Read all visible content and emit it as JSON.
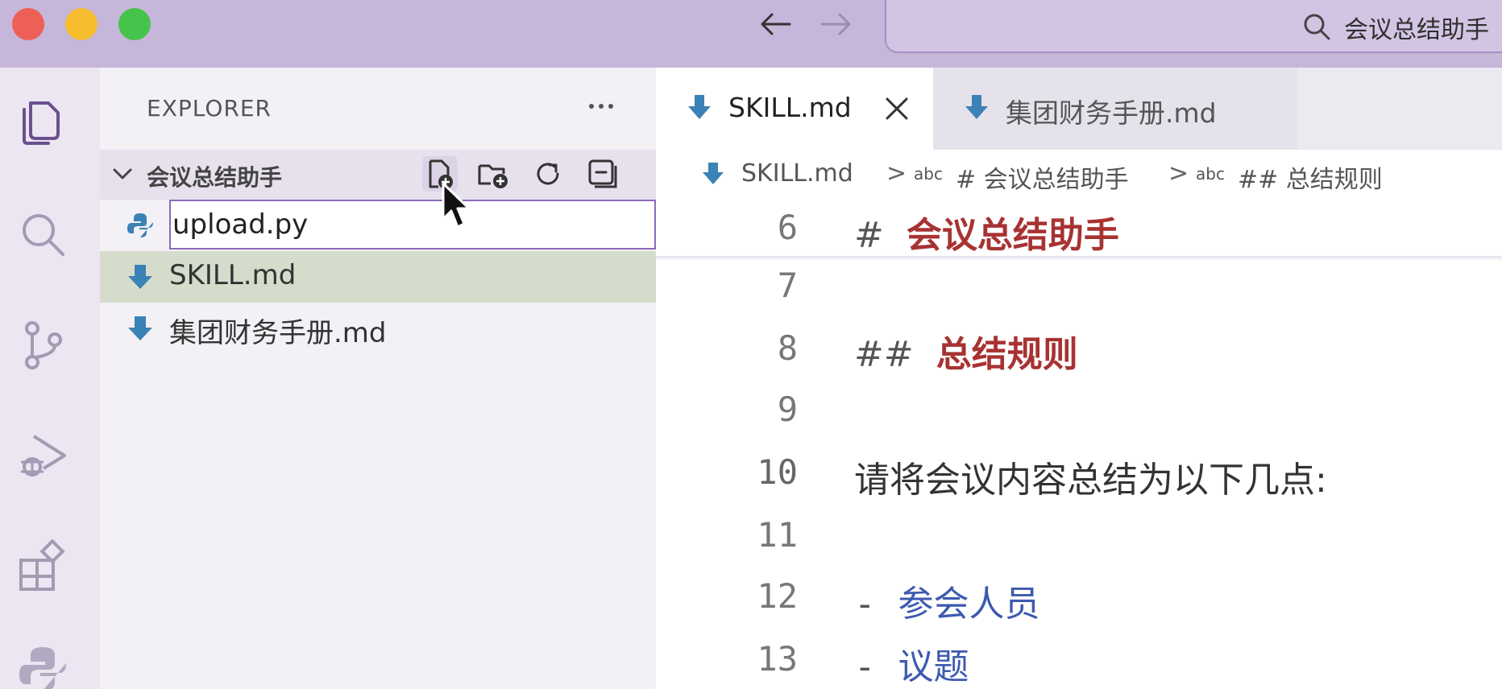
{
  "window": {
    "search_text": "会议总结助手",
    "icons": {
      "back": "arrow-left-icon",
      "forward": "arrow-right-icon",
      "search": "search-icon"
    }
  },
  "activity_bar": {
    "items": [
      "explorer-icon",
      "search-icon",
      "source-control-icon",
      "run-debug-icon",
      "extensions-icon",
      "python-icon"
    ]
  },
  "sidebar": {
    "title": "EXPLORER",
    "folder": {
      "name": "会议总结助手",
      "expanded": true
    },
    "toolbar": [
      "new-file-icon",
      "new-folder-icon",
      "refresh-icon",
      "collapse-all-icon"
    ],
    "rename_input_value": "upload.py",
    "files": [
      {
        "name": "SKILL.md",
        "icon": "markdown-icon",
        "selected": true
      },
      {
        "name": "集团财务手册.md",
        "icon": "markdown-icon",
        "selected": false
      }
    ]
  },
  "editor": {
    "tabs": [
      {
        "label": "SKILL.md",
        "active": true
      },
      {
        "label": "集团财务手册.md",
        "active": false
      }
    ],
    "breadcrumb": {
      "file": "SKILL.md",
      "sep": ">",
      "abc": "abc",
      "h1": "# 会议总结助手",
      "h2": "## 总结规则"
    },
    "lines": {
      "l6": {
        "no": "6",
        "hash": "#",
        "text": "会议总结助手"
      },
      "l7": {
        "no": "7"
      },
      "l8": {
        "no": "8",
        "hash": "##",
        "text": "总结规则"
      },
      "l9": {
        "no": "9"
      },
      "l10": {
        "no": "10",
        "text": "请将会议内容总结为以下几点:"
      },
      "l11": {
        "no": "11"
      },
      "l12": {
        "no": "12",
        "bullet": "-",
        "text": "参会人员"
      },
      "l13": {
        "no": "13",
        "bullet": "-",
        "text": "议题"
      }
    }
  },
  "colors": {
    "titlebar": "#c6b6d9",
    "selected_row": "#d5dccb",
    "heading": "#a83232",
    "list_text": "#3d5ab0",
    "markdown_icon": "#3b82b6"
  }
}
